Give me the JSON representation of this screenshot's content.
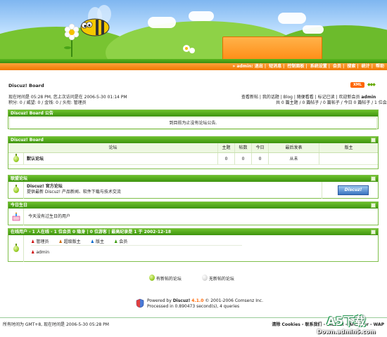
{
  "topnav": {
    "user": "admin",
    "items": [
      "退出",
      "短消息",
      "控制面板",
      "系统设置",
      "会员",
      "搜索",
      "统计",
      "帮助"
    ]
  },
  "board_title": "Discuz! Board",
  "xml_badge": "XML",
  "info": {
    "time_line": "现在时间是  05:28 PM, 您上次访问是在  2006-5-30 01:14 PM",
    "points_line": "积分: 0 / 威望: 0 / 金钱: 0 / 头衔: 管理员",
    "links_line": "查看新帖 | 我的话题 | Blog | 随便看看 | 标记已读 | 欢迎新会员",
    "new_member": "admin",
    "stats_line": "共 0 篇主题 / 0 篇帖子 / 0 篇帖子 / 今日 0 篇帖子 / 1 位会员"
  },
  "announcement": {
    "title": "Discuz! Board 公告",
    "message": "到目前为止没有论坛公告."
  },
  "forum_section": {
    "title": "Discuz! Board",
    "headers": [
      "论坛",
      "主题",
      "帖数",
      "今日",
      "最后发表",
      "版主"
    ],
    "rows": [
      {
        "name": "默认论坛",
        "threads": "0",
        "posts": "0",
        "today": "0",
        "last": "从未",
        "mods": ""
      }
    ]
  },
  "league": {
    "title": "联盟论坛",
    "name": "Discuz! 官方论坛",
    "desc": "提供最新 Discuz! 产品新闻、软件下载与技术交流",
    "logo": "Discuz!"
  },
  "birthday": {
    "title": "今日生日",
    "message": "今天没有过生日的用户"
  },
  "online": {
    "title": "在线用户 - 1 人在线 - 1 位会员 0 隐身 | 0 位游客 | 最高纪录是 1 于 2002-12-18",
    "legend": [
      "管理员",
      "超级版主",
      "版主",
      "会员"
    ],
    "users": [
      "admin"
    ]
  },
  "legend_bottom": {
    "new": "有新帖的论坛",
    "nonew": "无新帖的论坛"
  },
  "footer": {
    "powered_label": "Powered by",
    "product": "Discuz!",
    "version": "4.1.0",
    "copyright": "© 2001-2006 Comsenz Inc.",
    "processed": "Processed in 0.890473 second(s), 4 queries",
    "timezone": "所有时间为  GMT+8, 现在时间是  2006-5-30 05:28 PM",
    "links": "清除  Cookies - 联系我们 - Discuz! - Archiver - WAP"
  },
  "watermark": {
    "big": "A5下载",
    "small": "Down.admin5.com"
  },
  "colors": {
    "accent_green": "#4aa318",
    "accent_orange": "#f08400"
  }
}
